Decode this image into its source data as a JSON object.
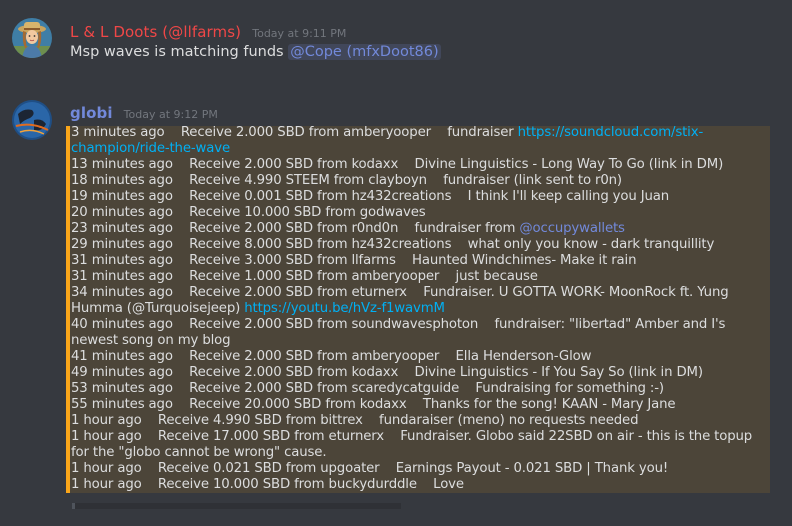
{
  "message1": {
    "author": "L & L Doots (@llfarms)",
    "timestamp": "Today at 9:11 PM",
    "text": "Msp waves is matching funds",
    "mention": "@Cope (mfxDoot86)"
  },
  "message2": {
    "author": "globi",
    "timestamp": "Today at 9:12 PM",
    "lines": [
      {
        "text": "3 minutes ago    Receive 2.000 SBD from amberyooper    fundraiser ",
        "link": "https://soundcloud.com/stix-champion/ride-the-wave"
      },
      {
        "text": "13 minutes ago    Receive 2.000 SBD from kodaxx    Divine Linguistics - Long Way To Go (link in DM)"
      },
      {
        "text": "18 minutes ago    Receive 4.990 STEEM from clayboyn    fundraiser (link sent to r0n)"
      },
      {
        "text": "19 minutes ago    Receive 0.001 SBD from hz432creations    I think I'll keep calling you Juan"
      },
      {
        "text": "20 minutes ago    Receive 10.000 SBD from godwaves"
      },
      {
        "text": "23 minutes ago    Receive 2.000 SBD from r0nd0n    fundraiser from ",
        "mention": "@occupywallets"
      },
      {
        "text": "29 minutes ago    Receive 8.000 SBD from hz432creations    what only you know - dark tranquillity"
      },
      {
        "text": "31 minutes ago    Receive 3.000 SBD from llfarms    Haunted Windchimes- Make it rain"
      },
      {
        "text": "31 minutes ago    Receive 1.000 SBD from amberyooper    just because"
      },
      {
        "text": "34 minutes ago    Receive 2.000 SBD from eturnerx    Fundraiser. U GOTTA WORK- MoonRock ft. Yung Humma (@Turquoisejeep) ",
        "link": "https://youtu.be/hVz-f1wavmM"
      },
      {
        "text": "40 minutes ago    Receive 2.000 SBD from soundwavesphoton    fundraiser: \"libertad\" Amber and I's newest song on my blog"
      },
      {
        "text": "41 minutes ago    Receive 2.000 SBD from amberyooper    Ella Henderson-Glow"
      },
      {
        "text": "49 minutes ago    Receive 2.000 SBD from kodaxx    Divine Linguistics - If You Say So (link in DM)"
      },
      {
        "text": "53 minutes ago    Receive 2.000 SBD from scaredycatguide    Fundraising for something :-)"
      },
      {
        "text": "55 minutes ago    Receive 20.000 SBD from kodaxx    Thanks for the song! KAAN - Mary Jane"
      },
      {
        "text": "1 hour ago    Receive 4.990 SBD from bittrex    fundaraiser (meno) no requests needed"
      },
      {
        "text": "1 hour ago    Receive 17.000 SBD from eturnerx    Fundraiser. Globo said 22SBD on air - this is the topup for the \"globo cannot be wrong\" cause."
      },
      {
        "text": "1 hour ago    Receive 0.021 SBD from upgoater    Earnings Payout - 0.021 SBD | Thank you!"
      },
      {
        "text": "1 hour ago    Receive 10.000 SBD from buckydurddle    Love"
      }
    ]
  },
  "colors": {
    "background": "#36393f",
    "author1": "#f04747",
    "author2": "#7289da",
    "link": "#00b0f4",
    "highlight_bar": "#faa61a"
  },
  "icons": {
    "avatar1": "farmer-girl-avatar",
    "avatar2": "globe-avatar"
  }
}
